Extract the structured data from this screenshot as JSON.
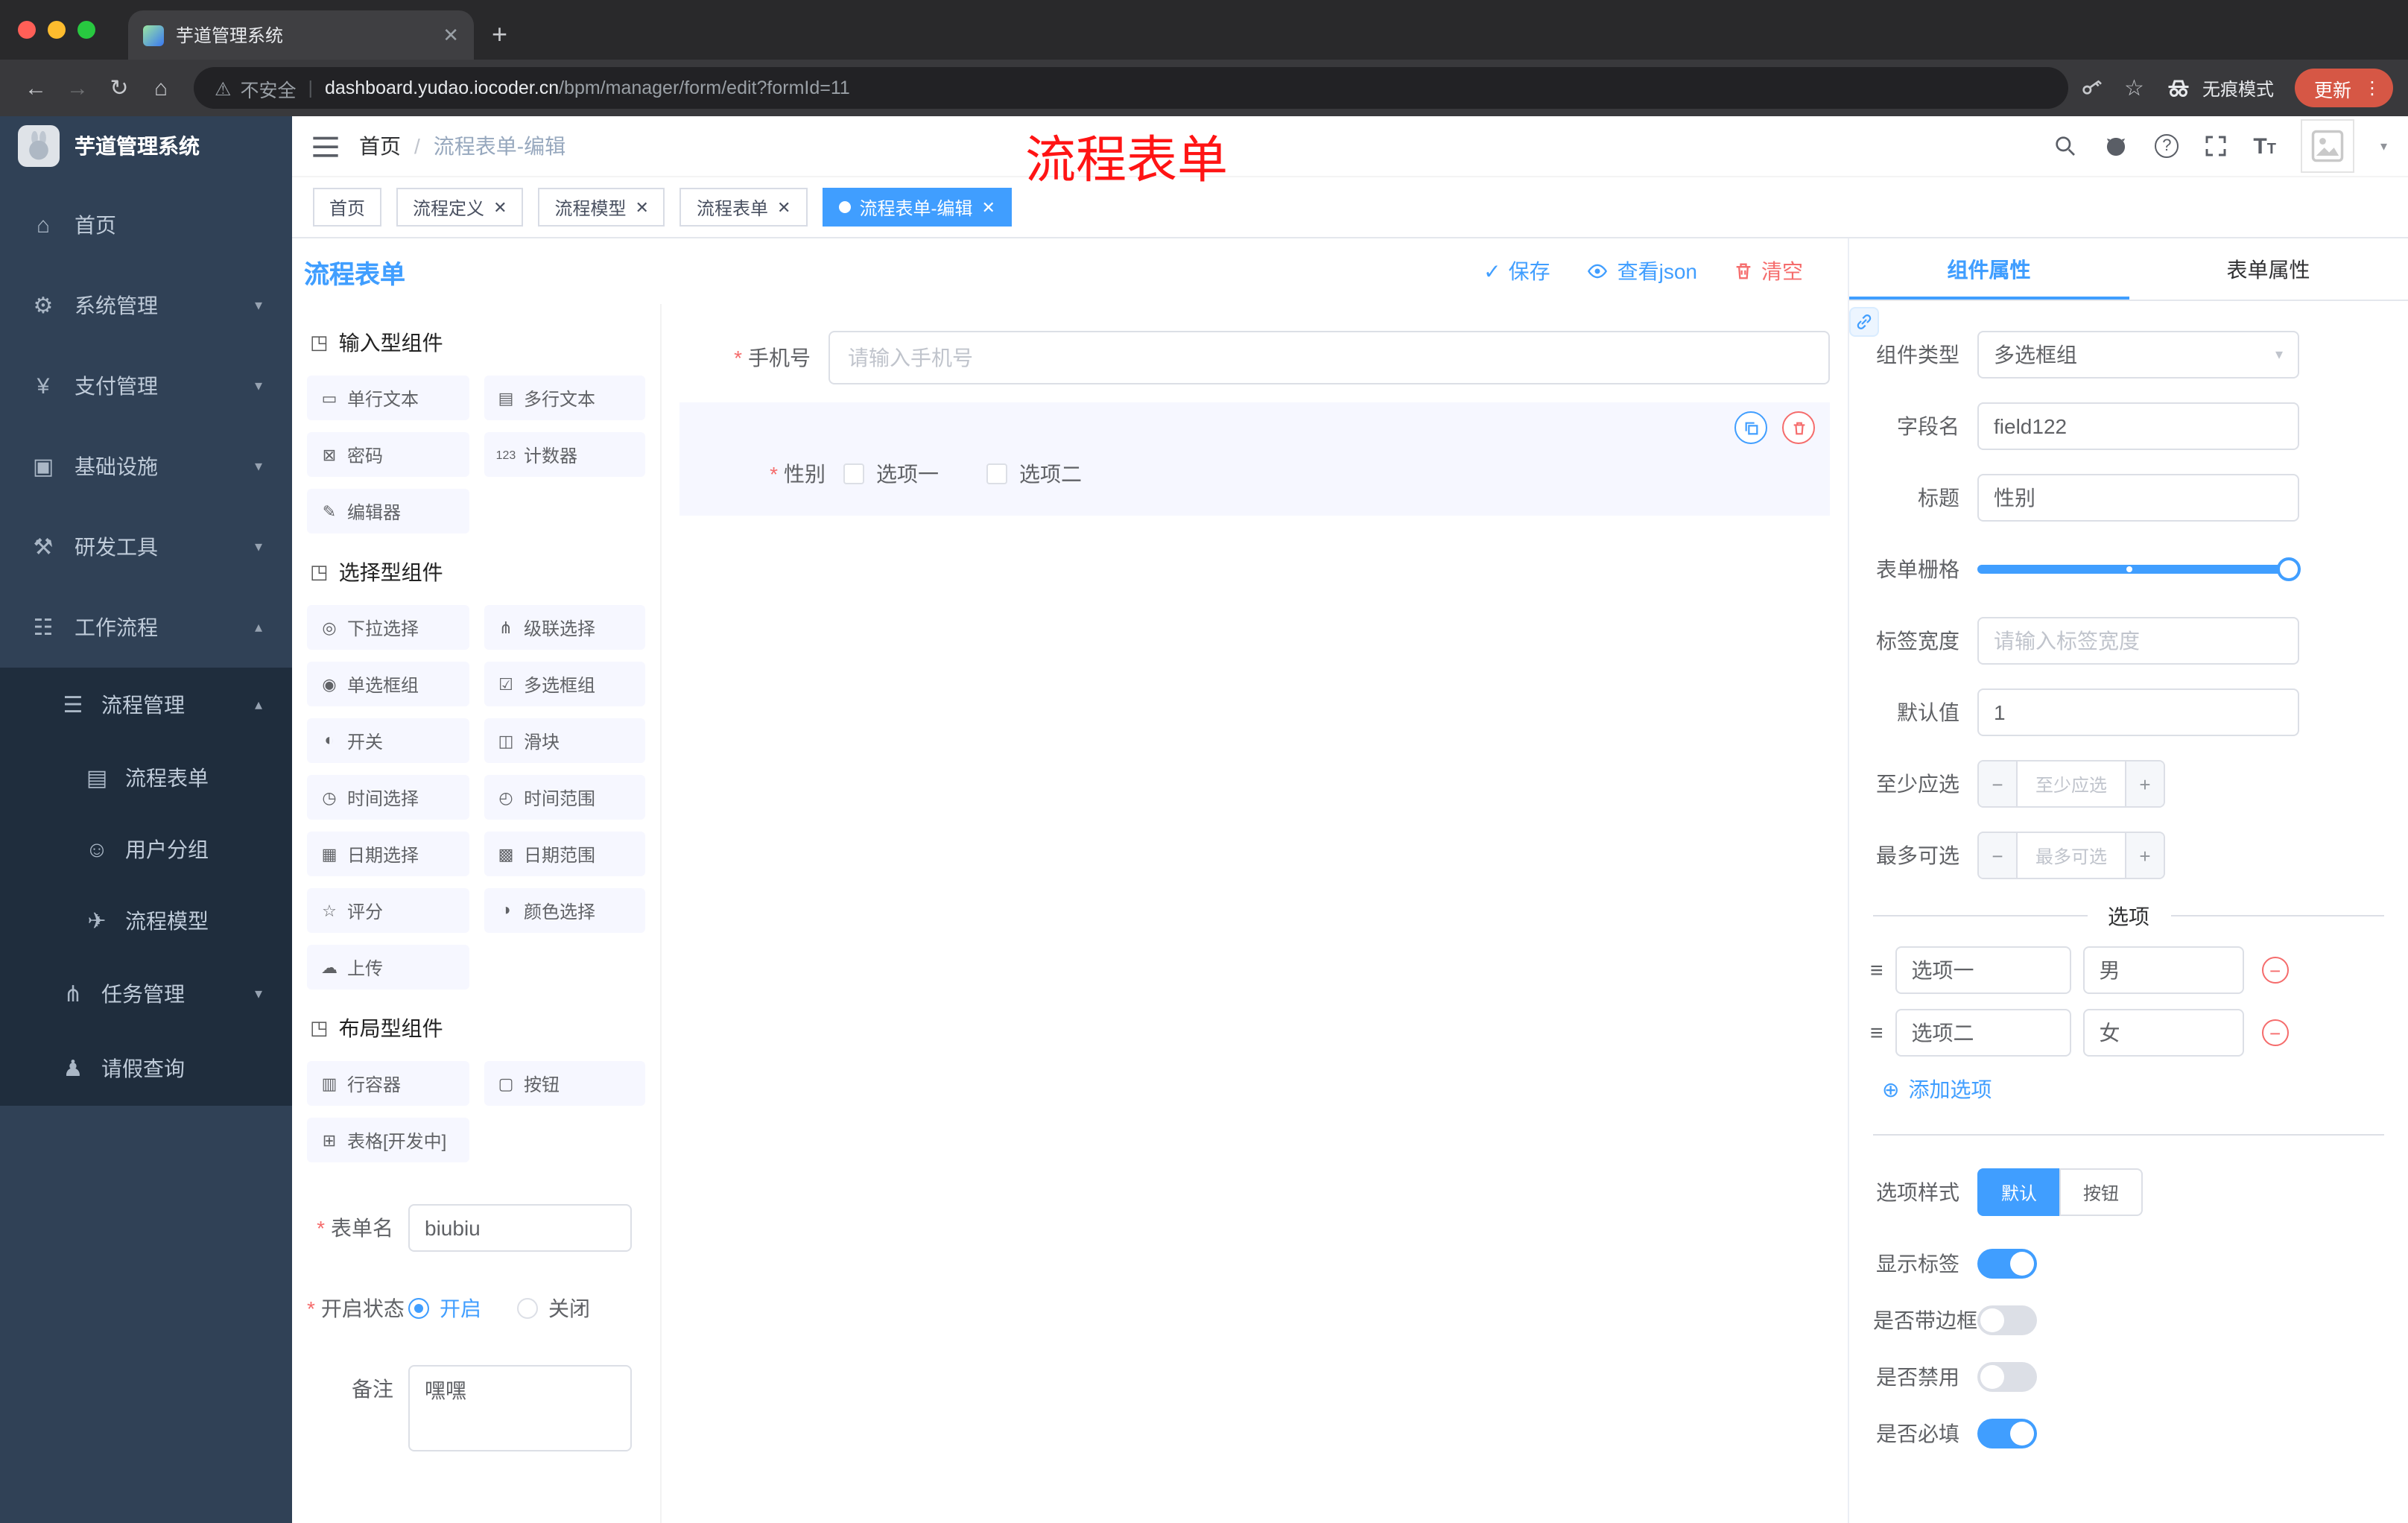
{
  "colors": {
    "accent": "#409eff",
    "danger": "#f56c6c",
    "annotation_red": "#ff1414",
    "sidebar_bg": "#304156",
    "submenu_bg": "#1f2d3d",
    "active_tag": "#409eff",
    "update_pill": "#d65745"
  },
  "browser": {
    "tab_title": "芋道管理系统",
    "new_tab": "+",
    "security_label": "不安全",
    "url_domain": "dashboard.yudao.iocoder.cn",
    "url_path": "/bpm/manager/form/edit?formId=11",
    "incognito_label": "无痕模式",
    "update_label": "更新"
  },
  "sidebar": {
    "logo_title": "芋道管理系统",
    "menu": [
      {
        "label": "首页",
        "icon": "home-icon",
        "glyph": "⌂",
        "chevron": ""
      },
      {
        "label": "系统管理",
        "icon": "gear-icon",
        "glyph": "⚙",
        "chevron": "▾"
      },
      {
        "label": "支付管理",
        "icon": "yen-icon",
        "glyph": "¥",
        "chevron": "▾"
      },
      {
        "label": "基础设施",
        "icon": "infrastructure-icon",
        "glyph": "▣",
        "chevron": "▾"
      },
      {
        "label": "研发工具",
        "icon": "tools-icon",
        "glyph": "⚒",
        "chevron": "▾"
      },
      {
        "label": "工作流程",
        "icon": "workflow-icon",
        "glyph": "☷",
        "chevron": "▴"
      }
    ],
    "process_mgmt": {
      "label": "流程管理",
      "glyph": "☰",
      "chevron": "▴"
    },
    "process_children": [
      {
        "label": "流程表单",
        "glyph": "▤"
      },
      {
        "label": "用户分组",
        "glyph": "☺"
      },
      {
        "label": "流程模型",
        "glyph": "✈"
      }
    ],
    "task_mgmt": {
      "label": "任务管理",
      "glyph": "⋔",
      "chevron": "▾"
    },
    "leave_query": {
      "label": "请假查询",
      "glyph": "♟"
    }
  },
  "header": {
    "breadcrumb_home": "首页",
    "breadcrumb_sep": "/",
    "breadcrumb_current": "流程表单-编辑",
    "annotation": "流程表单",
    "font_size_icon": "T"
  },
  "tags": [
    {
      "label": "首页"
    },
    {
      "label": "流程定义"
    },
    {
      "label": "流程模型"
    },
    {
      "label": "流程表单"
    },
    {
      "label": "流程表单-编辑"
    }
  ],
  "designer": {
    "title": "流程表单",
    "save": "保存",
    "view_json": "查看json",
    "clear": "清空"
  },
  "palette": {
    "sections": [
      {
        "title": "输入型组件",
        "glyph": "◳",
        "items": [
          {
            "label": "单行文本",
            "glyph": "▭"
          },
          {
            "label": "多行文本",
            "glyph": "▤"
          },
          {
            "label": "密码",
            "glyph": "⊠"
          },
          {
            "label": "计数器",
            "glyph": "123"
          },
          {
            "label": "编辑器",
            "glyph": "✎"
          }
        ]
      },
      {
        "title": "选择型组件",
        "glyph": "◳",
        "items": [
          {
            "label": "下拉选择",
            "glyph": "◎"
          },
          {
            "label": "级联选择",
            "glyph": "⋔"
          },
          {
            "label": "单选框组",
            "glyph": "◉"
          },
          {
            "label": "多选框组",
            "glyph": "☑"
          },
          {
            "label": "开关",
            "glyph": "◐"
          },
          {
            "label": "滑块",
            "glyph": "◫"
          },
          {
            "label": "时间选择",
            "glyph": "◷"
          },
          {
            "label": "时间范围",
            "glyph": "◴"
          },
          {
            "label": "日期选择",
            "glyph": "▦"
          },
          {
            "label": "日期范围",
            "glyph": "▩"
          },
          {
            "label": "评分",
            "glyph": "☆"
          },
          {
            "label": "颜色选择",
            "glyph": "◑"
          },
          {
            "label": "上传",
            "glyph": "☁"
          }
        ]
      },
      {
        "title": "布局型组件",
        "glyph": "◳",
        "items": [
          {
            "label": "行容器",
            "glyph": "▥"
          },
          {
            "label": "按钮",
            "glyph": "▢"
          },
          {
            "label": "表格[开发中]",
            "glyph": "⊞"
          }
        ]
      }
    ]
  },
  "meta": {
    "name_label": "表单名",
    "name_value": "biubiu",
    "status_label": "开启状态",
    "status_on": "开启",
    "status_off": "关闭",
    "remark_label": "备注",
    "remark_value": "嘿嘿"
  },
  "canvas": {
    "phone_label": "手机号",
    "phone_placeholder": "请输入手机号",
    "gender_label": "性别",
    "gender_options": [
      {
        "label": "选项一"
      },
      {
        "label": "选项二"
      }
    ]
  },
  "props": {
    "tab_component": "组件属性",
    "tab_form": "表单属性",
    "type_label": "组件类型",
    "type_value": "多选框组",
    "field_label": "字段名",
    "field_value": "field122",
    "title_label": "标题",
    "title_value": "性别",
    "grid_label": "表单栅格",
    "width_label": "标签宽度",
    "width_placeholder": "请输入标签宽度",
    "default_label": "默认值",
    "default_value": "1",
    "min_label": "至少应选",
    "min_placeholder": "至少应选",
    "max_label": "最多可选",
    "max_placeholder": "最多可选",
    "minus": "−",
    "plus": "+",
    "options_title": "选项",
    "options": [
      {
        "name": "选项一",
        "value": "男"
      },
      {
        "name": "选项二",
        "value": "女"
      }
    ],
    "add_option": "添加选项",
    "add_icon": "⊕",
    "style_label": "选项样式",
    "style_default": "默认",
    "style_button": "按钮",
    "switches": [
      {
        "label": "显示标签",
        "on": true
      },
      {
        "label": "是否带边框",
        "on": false
      },
      {
        "label": "是否禁用",
        "on": false
      },
      {
        "label": "是否必填",
        "on": true
      }
    ]
  }
}
